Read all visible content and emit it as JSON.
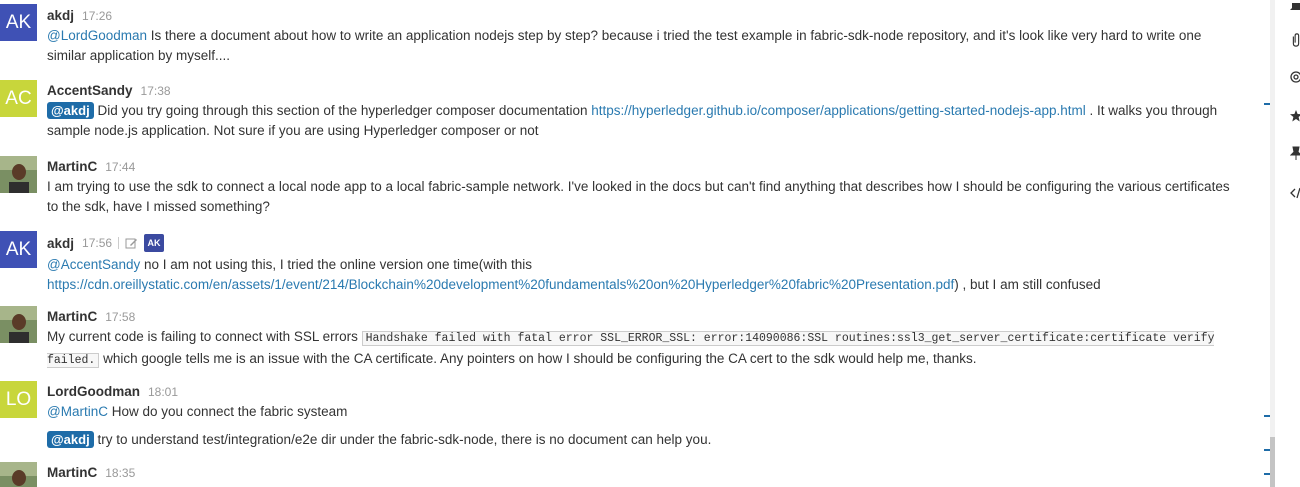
{
  "messages": [
    {
      "avatar_text": "AK",
      "avatar_color": "#3f51b5",
      "user": "akdj",
      "time": "17:26",
      "mention": "@LordGoodman",
      "text": " Is there a document about how to write an application nodejs step by step? because i tried the test example in fabric-sdk-node repository, and it's look like very hard to write one similar application by myself...."
    },
    {
      "avatar_text": "AC",
      "avatar_color": "#c8d63b",
      "user": "AccentSandy",
      "time": "17:38",
      "pill": "@akdj",
      "text_before": " Did you try going through this section of the hyperledger composer documentation ",
      "link": "https://hyperledger.github.io/composer/applications/getting-started-nodejs-app.html",
      "text_after": " . It walks you through sample node.js application. Not sure if you are using Hyperledger composer or not"
    },
    {
      "user": "MartinC",
      "time": "17:44",
      "text": "I am trying to use the sdk to connect a local node app to a local fabric-sample network. I've looked in the docs but can't find anything that describes how I should be configuring the various certificates to the sdk, have I missed something?"
    },
    {
      "avatar_text": "AK",
      "avatar_color": "#3f51b5",
      "user": "akdj",
      "time": "17:56",
      "mini_avatar": "AK",
      "mention": "@AccentSandy",
      "text_before": " no I am not using this, I tried the online version one time(with this ",
      "link": "https://cdn.oreillystatic.com/en/assets/1/event/214/Blockchain%20development%20fundamentals%20on%20Hyperledger%20fabric%20Presentation.pdf",
      "text_after": ") , but I am still confused"
    },
    {
      "user": "MartinC",
      "time": "17:58",
      "text_before": "My current code is failing to connect with SSL errors ",
      "code": "Handshake failed with fatal error SSL_ERROR_SSL: error:14090086:SSL routines:ssl3_get_server_certificate:certificate verify failed.",
      "text_after": " which google tells me is an issue with the CA certificate. Any pointers on how I should be configuring the CA cert to the sdk would help me, thanks."
    },
    {
      "avatar_text": "LO",
      "avatar_color": "#c8d63b",
      "user": "LordGoodman",
      "time": "18:01",
      "mention": "@MartinC",
      "text": " How do you connect the fabric systeam",
      "followup_pill": "@akdj",
      "followup_text": " try to understand test/integration/e2e dir under the fabric-sdk-node, there is no document can help you."
    },
    {
      "user": "MartinC",
      "time": "18:35"
    }
  ],
  "right_icons": [
    "bell-icon",
    "paperclip-icon",
    "at-icon",
    "star-icon",
    "pin-icon",
    "code-icon"
  ],
  "colors": {
    "accent": "#1e6ca8",
    "link": "#2a7ab0"
  }
}
